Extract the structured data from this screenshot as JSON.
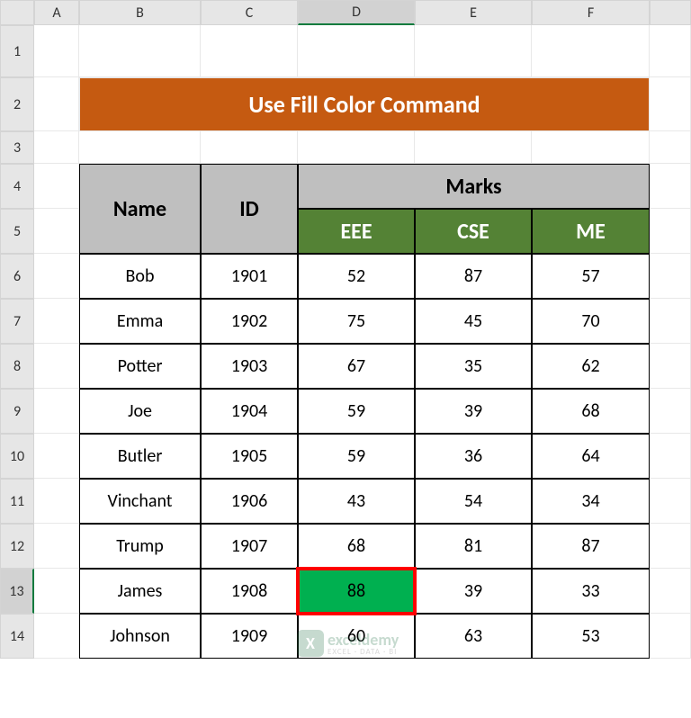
{
  "columns": [
    "A",
    "B",
    "C",
    "D",
    "E",
    "F"
  ],
  "rows": [
    "1",
    "2",
    "3",
    "4",
    "5",
    "6",
    "7",
    "8",
    "9",
    "10",
    "11",
    "12",
    "13",
    "14"
  ],
  "active_column": "D",
  "active_row": "13",
  "banner": {
    "title": "Use Fill Color Command"
  },
  "table": {
    "headers": {
      "name": "Name",
      "id": "ID",
      "marks": "Marks",
      "subjects": [
        "EEE",
        "CSE",
        "ME"
      ]
    },
    "rows": [
      {
        "name": "Bob",
        "id": "1901",
        "marks": [
          "52",
          "87",
          "57"
        ]
      },
      {
        "name": "Emma",
        "id": "1902",
        "marks": [
          "75",
          "45",
          "70"
        ]
      },
      {
        "name": "Potter",
        "id": "1903",
        "marks": [
          "67",
          "35",
          "62"
        ]
      },
      {
        "name": "Joe",
        "id": "1904",
        "marks": [
          "59",
          "39",
          "68"
        ]
      },
      {
        "name": "Butler",
        "id": "1905",
        "marks": [
          "59",
          "36",
          "64"
        ]
      },
      {
        "name": "Vinchant",
        "id": "1906",
        "marks": [
          "43",
          "54",
          "34"
        ]
      },
      {
        "name": "Trump",
        "id": "1907",
        "marks": [
          "68",
          "81",
          "87"
        ]
      },
      {
        "name": "James",
        "id": "1908",
        "marks": [
          "88",
          "39",
          "33"
        ]
      },
      {
        "name": "Johnson",
        "id": "1909",
        "marks": [
          "60",
          "63",
          "53"
        ]
      }
    ]
  },
  "highlight": {
    "row": 7,
    "col": 0
  },
  "watermark": {
    "logo_letter": "X",
    "line1": "exceldemy",
    "line2": "EXCEL · DATA · BI"
  },
  "chart_data": {
    "type": "table",
    "title": "Use Fill Color Command",
    "columns": [
      "Name",
      "ID",
      "EEE",
      "CSE",
      "ME"
    ],
    "rows": [
      [
        "Bob",
        "1901",
        52,
        87,
        57
      ],
      [
        "Emma",
        "1902",
        75,
        45,
        70
      ],
      [
        "Potter",
        "1903",
        67,
        35,
        62
      ],
      [
        "Joe",
        "1904",
        59,
        39,
        68
      ],
      [
        "Butler",
        "1905",
        59,
        36,
        64
      ],
      [
        "Vinchant",
        "1906",
        43,
        54,
        34
      ],
      [
        "Trump",
        "1907",
        68,
        81,
        87
      ],
      [
        "James",
        "1908",
        88,
        39,
        33
      ],
      [
        "Johnson",
        "1909",
        60,
        63,
        53
      ]
    ]
  }
}
